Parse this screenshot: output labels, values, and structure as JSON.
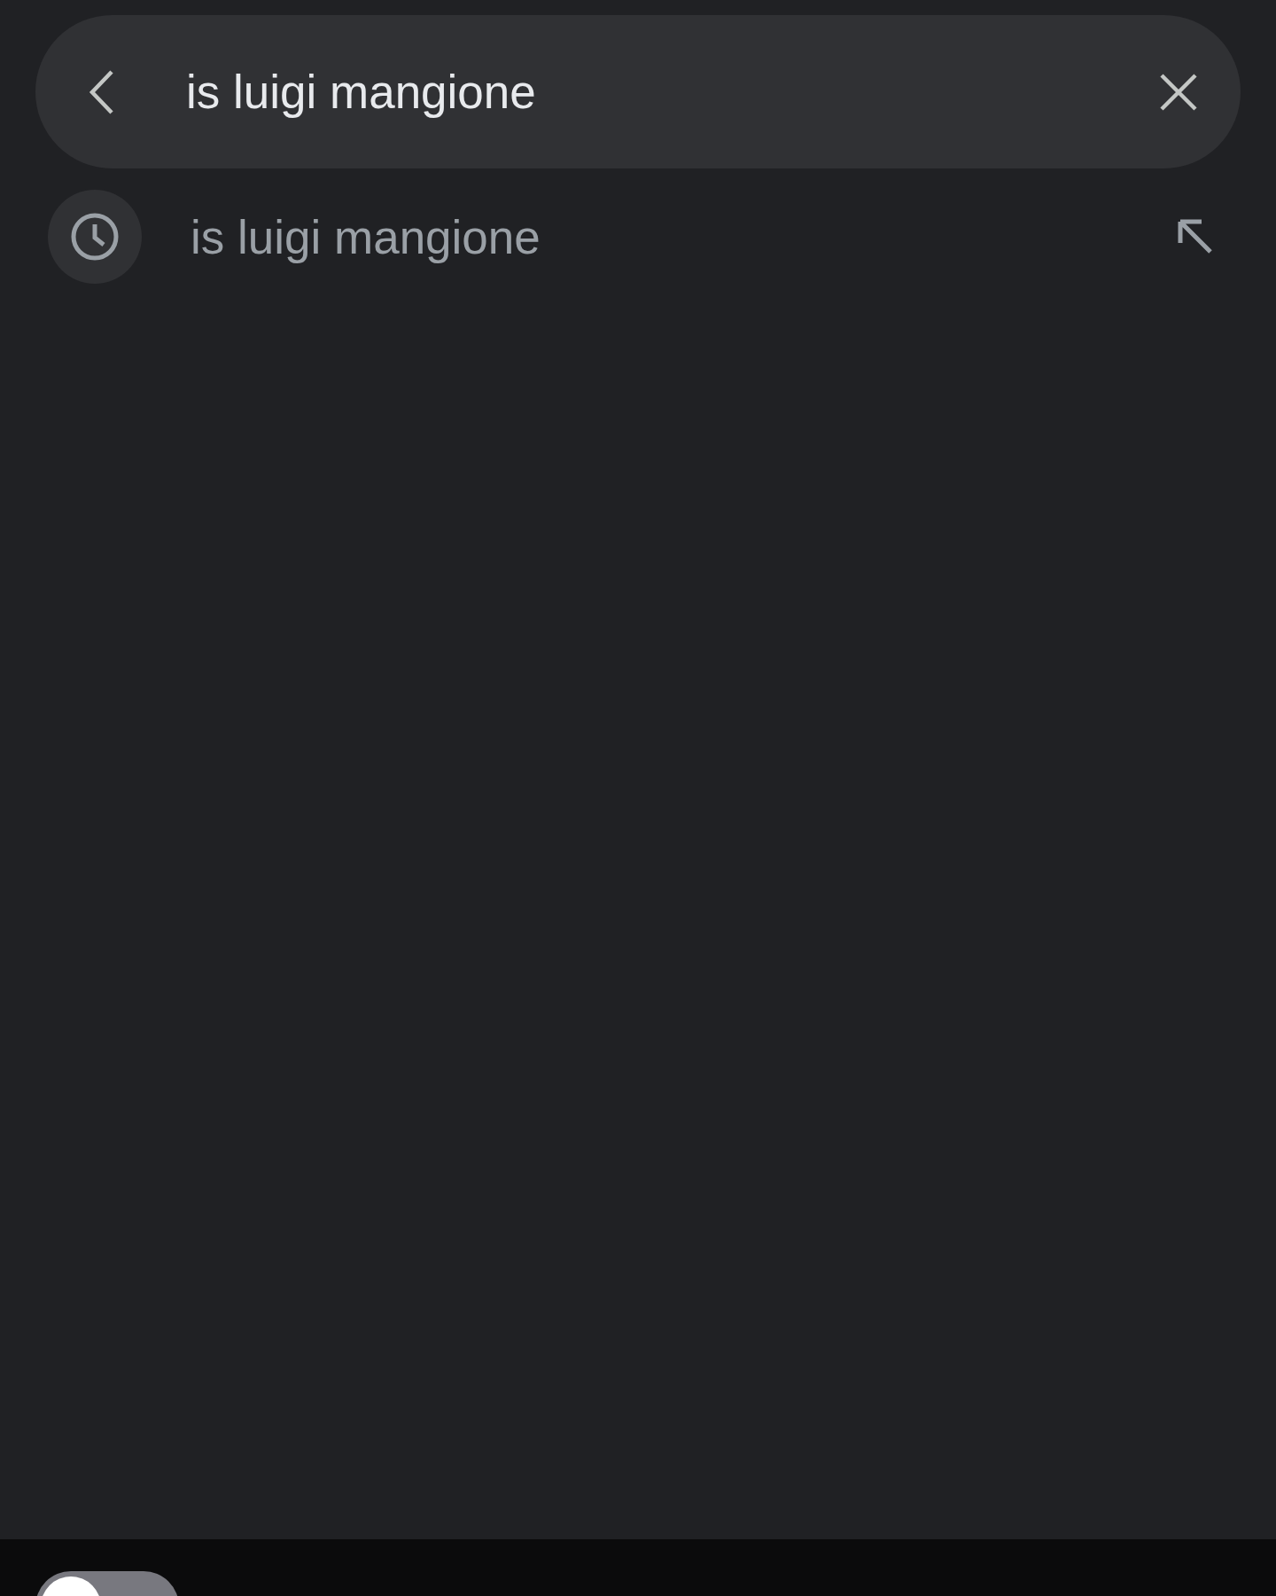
{
  "search": {
    "value": "is luigi mangione"
  },
  "suggestions": [
    {
      "text": "is luigi mangione",
      "kind": "history"
    }
  ],
  "toggle": {
    "on": false
  }
}
